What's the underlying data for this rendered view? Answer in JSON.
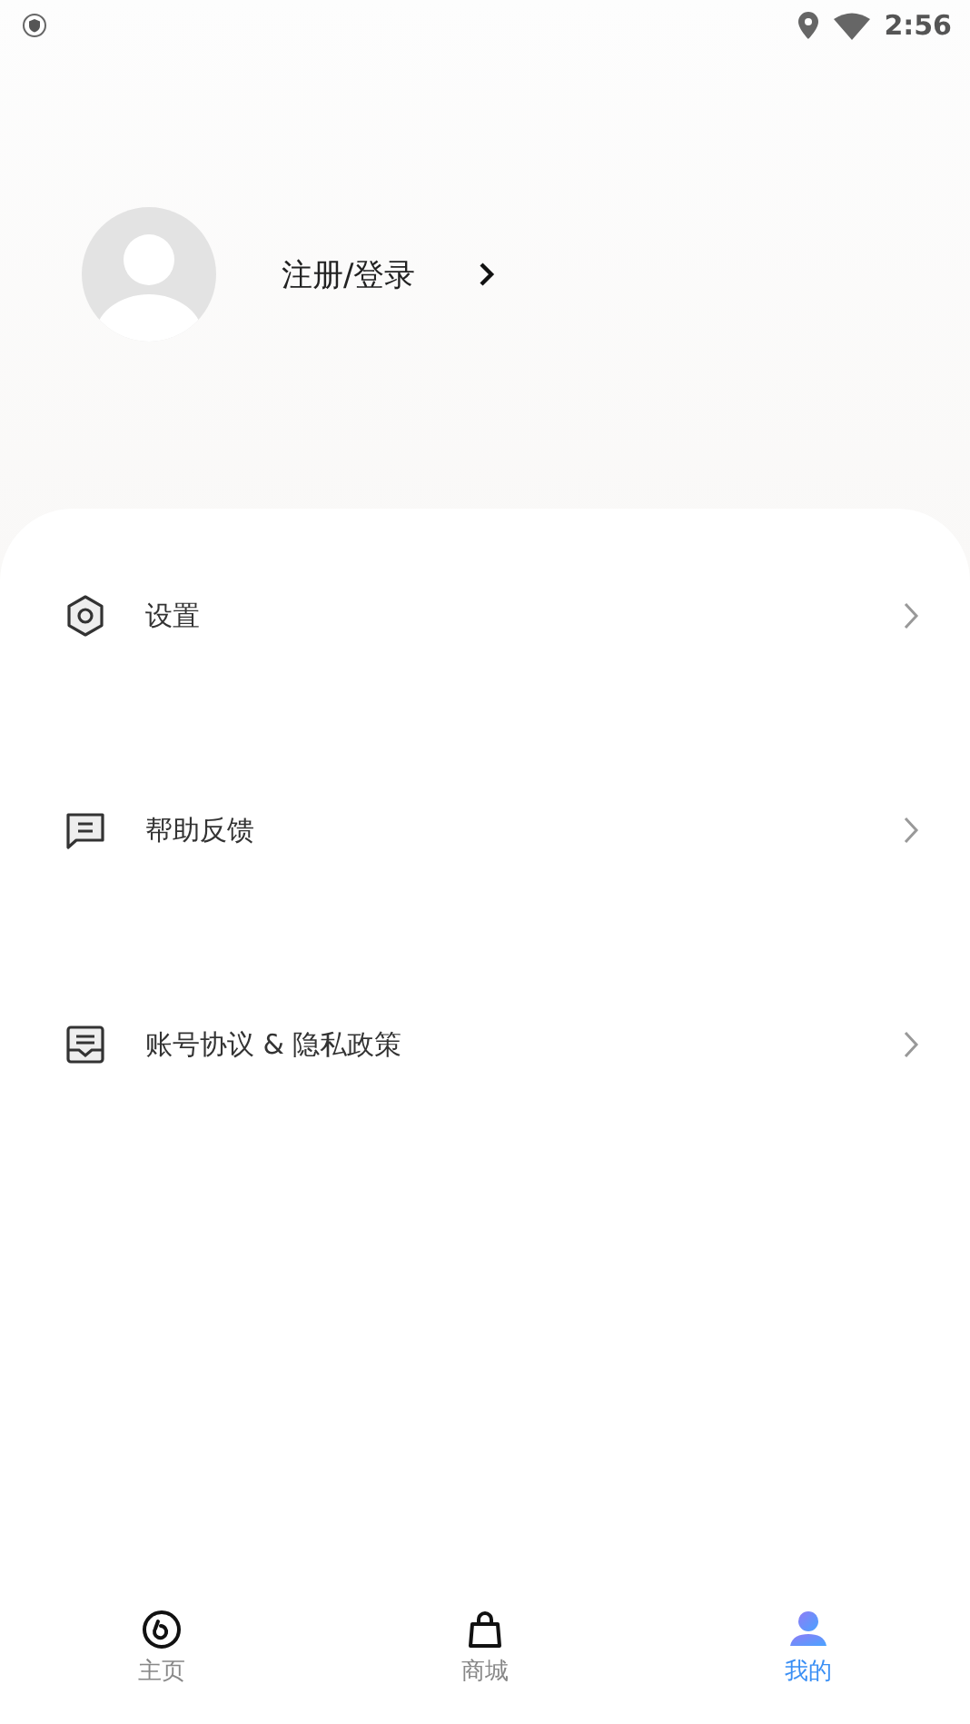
{
  "status_bar": {
    "time": "2:56"
  },
  "profile": {
    "login_label": "注册/登录"
  },
  "menu": [
    {
      "kind": "settings",
      "label": "设置"
    },
    {
      "kind": "feedback",
      "label": "帮助反馈"
    },
    {
      "kind": "document",
      "label": "账号协议 & 隐私政策"
    }
  ],
  "bottom_nav": [
    {
      "kind": "home",
      "label": "主页",
      "selected": false
    },
    {
      "kind": "shop",
      "label": "商城",
      "selected": false
    },
    {
      "kind": "profile",
      "label": "我的",
      "selected": true
    }
  ]
}
